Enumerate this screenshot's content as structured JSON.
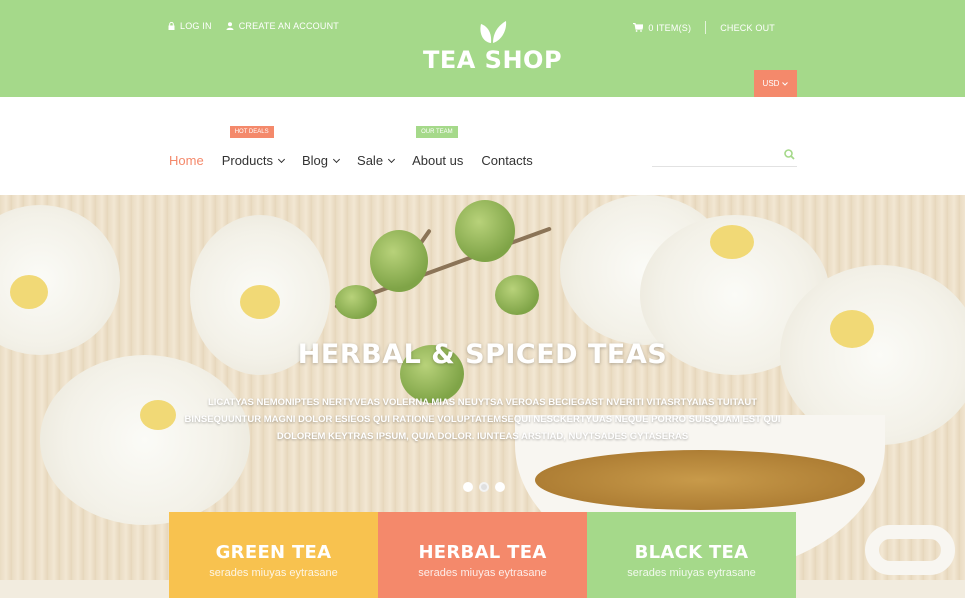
{
  "header": {
    "login": "LOG IN",
    "create_account": "CREATE AN ACCOUNT",
    "cart": "0 ITEM(S)",
    "checkout": "CHECK OUT",
    "logo_text": "TEA SHOP",
    "currency": "USD"
  },
  "nav": {
    "items": [
      {
        "label": "Home"
      },
      {
        "label": "Products",
        "badge": "HOT DEALS"
      },
      {
        "label": "Blog"
      },
      {
        "label": "Sale"
      },
      {
        "label": "About us",
        "badge": "OUR TEAM"
      },
      {
        "label": "Contacts"
      }
    ],
    "search_placeholder": ""
  },
  "hero": {
    "title": "HERBAL & SPICED TEAS",
    "text": "LICATYAS NEMONIPTES NERTYVEAS VOLERNA MIAS NEUYTSA VEROAS BECIEGAST NVERITI VITASRTYAIAS TUITAUT BINSEQUUNTUR MAGNI DOLOR ESIEOS QUI RATIONE VOLUPTATEMSEQUI NESCKERTYUAS NEQUE PORRO SUISQUAM EST QUI DOLOREM KEYTRAS IPSUM, QUIA DOLOR. IUNTEAS ARSTIAD, NUYTSADES GYTASERAS"
  },
  "tiles": [
    {
      "title": "GREEN TEA",
      "sub": "serades miuyas eytrasane"
    },
    {
      "title": "HERBAL TEA",
      "sub": "serades miuyas eytrasane"
    },
    {
      "title": "BLACK TEA",
      "sub": "serades miuyas eytrasane"
    }
  ],
  "colors": {
    "header_green": "#a5d98a",
    "accent_orange": "#f4896b",
    "yellow": "#f8c24f"
  }
}
